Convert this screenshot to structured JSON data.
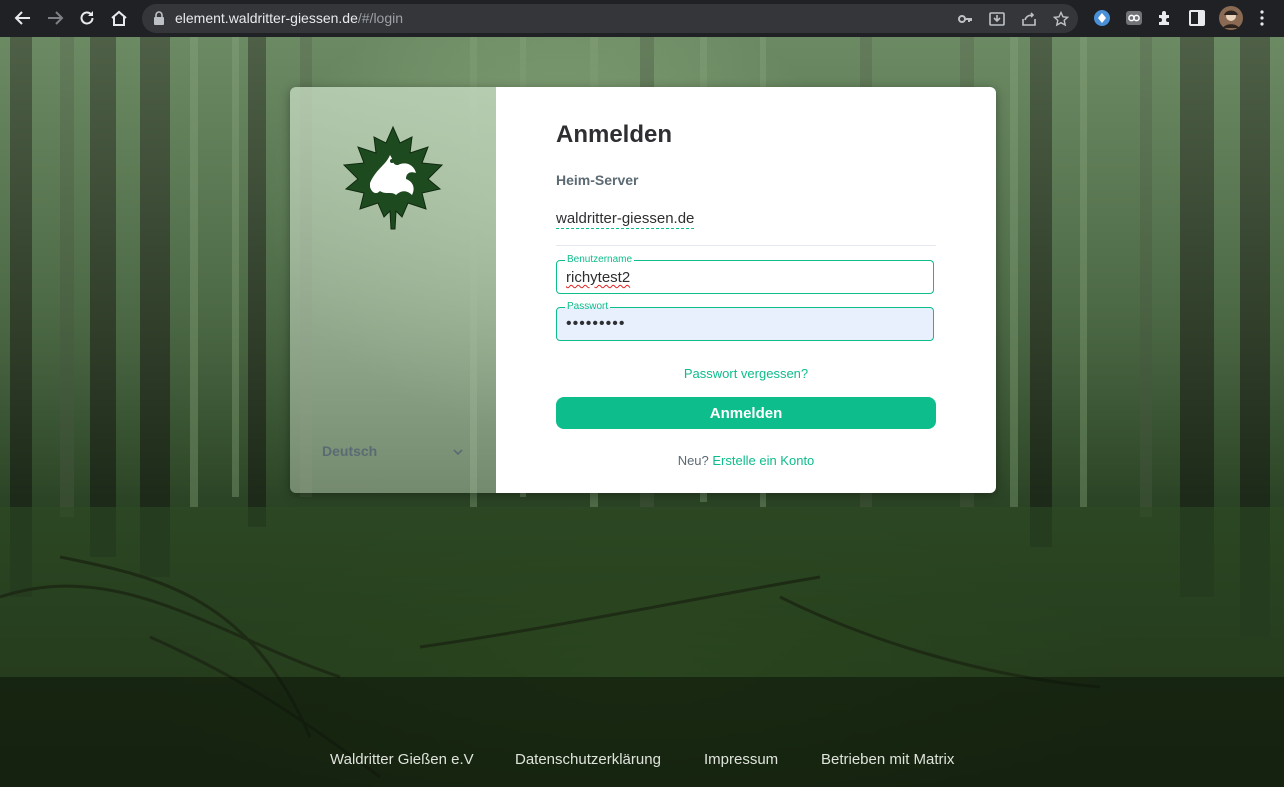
{
  "browser": {
    "url_host": "element.waldritter-giessen.de",
    "url_path": "/#/login"
  },
  "login": {
    "title": "Anmelden",
    "homeserver_label": "Heim-Server",
    "homeserver_value": "waldritter-giessen.de",
    "username_label": "Benutzername",
    "username_value": "richytest2",
    "password_label": "Passwort",
    "password_value": "•••••••••",
    "forgot_password": "Passwort vergessen?",
    "submit_label": "Anmelden",
    "create_prefix": "Neu?",
    "create_link": "Erstelle ein Konto"
  },
  "sidebar": {
    "language": "Deutsch"
  },
  "footer": {
    "links": [
      "Waldritter Gießen e.V",
      "Datenschutzerklärung",
      "Impressum",
      "Betrieben mit Matrix"
    ]
  },
  "colors": {
    "accent": "#0dbd8b",
    "logo_green": "#1e4a1f"
  },
  "icons": [
    "back-icon",
    "forward-icon",
    "reload-icon",
    "home-icon",
    "lock-icon",
    "key-icon",
    "install-icon",
    "share-icon",
    "star-icon",
    "extension-icon",
    "sidepanel-icon",
    "profile-avatar",
    "menu-icon",
    "chevron-down-icon"
  ]
}
